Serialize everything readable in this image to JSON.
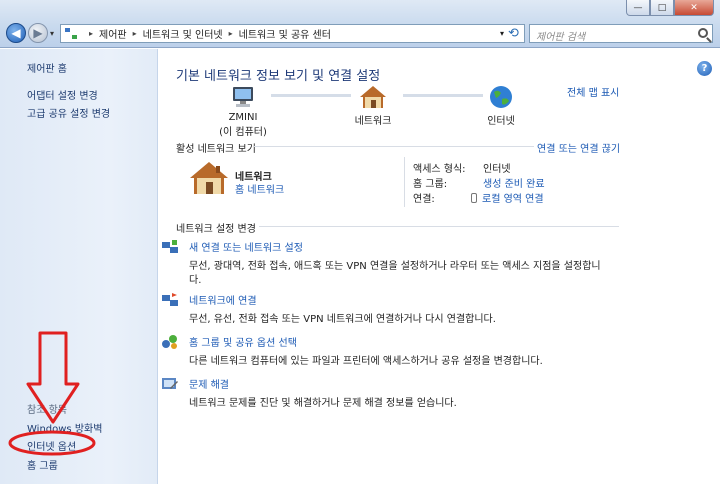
{
  "window": {
    "minimize": "—",
    "maximize": "□",
    "close": "✕"
  },
  "address": {
    "crumbs": [
      "제어판",
      "네트워크 및 인터넷",
      "네트워크 및 공유 센터"
    ],
    "search_placeholder": "제어판 검색"
  },
  "sidebar": {
    "items": [
      {
        "label": "제어판 홈"
      },
      {
        "label": "어댑터 설정 변경"
      },
      {
        "label": "고급 공유 설정 변경"
      }
    ],
    "see_also": {
      "heading": "참조 항목",
      "items": [
        {
          "label": "Windows 방화벽"
        },
        {
          "label": "인터넷 옵션"
        },
        {
          "label": "홈 그룹"
        }
      ]
    }
  },
  "main": {
    "title": "기본 네트워크 정보 보기 및 연결 설정",
    "full_map": "전체 맵 표시",
    "map": {
      "computer_name": "ZMINI",
      "computer_sub": "(이 컴퓨터)",
      "network": "네트워크",
      "internet": "인터넷"
    },
    "active_networks": {
      "label": "활성 네트워크 보기",
      "disconnect": "연결 또는 연결 끊기",
      "name": "네트워크",
      "type": "홈 네트워크",
      "access_type_label": "액세스 형식:",
      "access_type_value": "인터넷",
      "homegroup_label": "홈 그룹:",
      "homegroup_value": "생성 준비 완료",
      "connection_label": "연결:",
      "connection_value": "로컬 영역 연결"
    },
    "settings": {
      "label": "네트워크 설정 변경",
      "tasks": [
        {
          "title": "새 연결 또는 네트워크 설정",
          "desc": "무선, 광대역, 전화 접속, 애드혹 또는 VPN 연결을 설정하거나 라우터 또는 액세스 지점을 설정합니다."
        },
        {
          "title": "네트워크에 연결",
          "desc": "무선, 유선, 전화 접속 또는 VPN 네트워크에 연결하거나 다시 연결합니다."
        },
        {
          "title": "홈 그룹 및 공유 옵션 선택",
          "desc": "다른 네트워크 컴퓨터에 있는 파일과 프린터에 액세스하거나 공유 설정을 변경합니다."
        },
        {
          "title": "문제 해결",
          "desc": "네트워크 문제를 진단 및 해결하거나 문제 해결 정보를 얻습니다."
        }
      ]
    }
  },
  "colors": {
    "link": "#1c5ab4",
    "title": "#1e3a78",
    "annotation": "#e02020"
  }
}
